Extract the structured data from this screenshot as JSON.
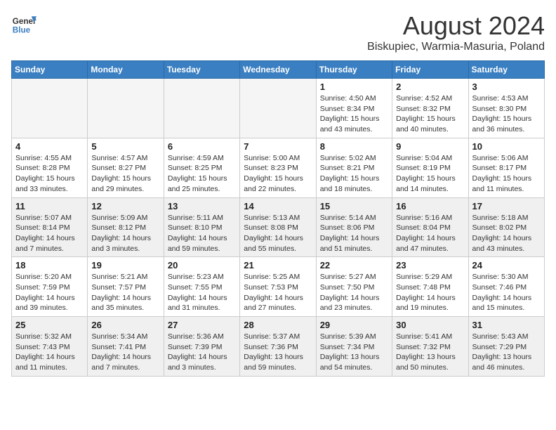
{
  "header": {
    "logo_general": "General",
    "logo_blue": "Blue",
    "month_title": "August 2024",
    "subtitle": "Biskupiec, Warmia-Masuria, Poland"
  },
  "weekdays": [
    "Sunday",
    "Monday",
    "Tuesday",
    "Wednesday",
    "Thursday",
    "Friday",
    "Saturday"
  ],
  "weeks": [
    [
      {
        "day": "",
        "empty": true
      },
      {
        "day": "",
        "empty": true
      },
      {
        "day": "",
        "empty": true
      },
      {
        "day": "",
        "empty": true
      },
      {
        "day": "1",
        "sunrise": "4:50 AM",
        "sunset": "8:34 PM",
        "daylight": "15 hours and 43 minutes."
      },
      {
        "day": "2",
        "sunrise": "4:52 AM",
        "sunset": "8:32 PM",
        "daylight": "15 hours and 40 minutes."
      },
      {
        "day": "3",
        "sunrise": "4:53 AM",
        "sunset": "8:30 PM",
        "daylight": "15 hours and 36 minutes."
      }
    ],
    [
      {
        "day": "4",
        "sunrise": "4:55 AM",
        "sunset": "8:28 PM",
        "daylight": "15 hours and 33 minutes."
      },
      {
        "day": "5",
        "sunrise": "4:57 AM",
        "sunset": "8:27 PM",
        "daylight": "15 hours and 29 minutes."
      },
      {
        "day": "6",
        "sunrise": "4:59 AM",
        "sunset": "8:25 PM",
        "daylight": "15 hours and 25 minutes."
      },
      {
        "day": "7",
        "sunrise": "5:00 AM",
        "sunset": "8:23 PM",
        "daylight": "15 hours and 22 minutes."
      },
      {
        "day": "8",
        "sunrise": "5:02 AM",
        "sunset": "8:21 PM",
        "daylight": "15 hours and 18 minutes."
      },
      {
        "day": "9",
        "sunrise": "5:04 AM",
        "sunset": "8:19 PM",
        "daylight": "15 hours and 14 minutes."
      },
      {
        "day": "10",
        "sunrise": "5:06 AM",
        "sunset": "8:17 PM",
        "daylight": "15 hours and 11 minutes."
      }
    ],
    [
      {
        "day": "11",
        "sunrise": "5:07 AM",
        "sunset": "8:14 PM",
        "daylight": "14 hours and 7 minutes.",
        "shaded": true
      },
      {
        "day": "12",
        "sunrise": "5:09 AM",
        "sunset": "8:12 PM",
        "daylight": "14 hours and 3 minutes.",
        "shaded": true
      },
      {
        "day": "13",
        "sunrise": "5:11 AM",
        "sunset": "8:10 PM",
        "daylight": "14 hours and 59 minutes.",
        "shaded": true
      },
      {
        "day": "14",
        "sunrise": "5:13 AM",
        "sunset": "8:08 PM",
        "daylight": "14 hours and 55 minutes.",
        "shaded": true
      },
      {
        "day": "15",
        "sunrise": "5:14 AM",
        "sunset": "8:06 PM",
        "daylight": "14 hours and 51 minutes.",
        "shaded": true
      },
      {
        "day": "16",
        "sunrise": "5:16 AM",
        "sunset": "8:04 PM",
        "daylight": "14 hours and 47 minutes.",
        "shaded": true
      },
      {
        "day": "17",
        "sunrise": "5:18 AM",
        "sunset": "8:02 PM",
        "daylight": "14 hours and 43 minutes.",
        "shaded": true
      }
    ],
    [
      {
        "day": "18",
        "sunrise": "5:20 AM",
        "sunset": "7:59 PM",
        "daylight": "14 hours and 39 minutes."
      },
      {
        "day": "19",
        "sunrise": "5:21 AM",
        "sunset": "7:57 PM",
        "daylight": "14 hours and 35 minutes."
      },
      {
        "day": "20",
        "sunrise": "5:23 AM",
        "sunset": "7:55 PM",
        "daylight": "14 hours and 31 minutes."
      },
      {
        "day": "21",
        "sunrise": "5:25 AM",
        "sunset": "7:53 PM",
        "daylight": "14 hours and 27 minutes."
      },
      {
        "day": "22",
        "sunrise": "5:27 AM",
        "sunset": "7:50 PM",
        "daylight": "14 hours and 23 minutes."
      },
      {
        "day": "23",
        "sunrise": "5:29 AM",
        "sunset": "7:48 PM",
        "daylight": "14 hours and 19 minutes."
      },
      {
        "day": "24",
        "sunrise": "5:30 AM",
        "sunset": "7:46 PM",
        "daylight": "14 hours and 15 minutes."
      }
    ],
    [
      {
        "day": "25",
        "sunrise": "5:32 AM",
        "sunset": "7:43 PM",
        "daylight": "14 hours and 11 minutes.",
        "shaded": true
      },
      {
        "day": "26",
        "sunrise": "5:34 AM",
        "sunset": "7:41 PM",
        "daylight": "14 hours and 7 minutes.",
        "shaded": true
      },
      {
        "day": "27",
        "sunrise": "5:36 AM",
        "sunset": "7:39 PM",
        "daylight": "14 hours and 3 minutes.",
        "shaded": true
      },
      {
        "day": "28",
        "sunrise": "5:37 AM",
        "sunset": "7:36 PM",
        "daylight": "13 hours and 59 minutes.",
        "shaded": true
      },
      {
        "day": "29",
        "sunrise": "5:39 AM",
        "sunset": "7:34 PM",
        "daylight": "13 hours and 54 minutes.",
        "shaded": true
      },
      {
        "day": "30",
        "sunrise": "5:41 AM",
        "sunset": "7:32 PM",
        "daylight": "13 hours and 50 minutes.",
        "shaded": true
      },
      {
        "day": "31",
        "sunrise": "5:43 AM",
        "sunset": "7:29 PM",
        "daylight": "13 hours and 46 minutes.",
        "shaded": true
      }
    ]
  ]
}
